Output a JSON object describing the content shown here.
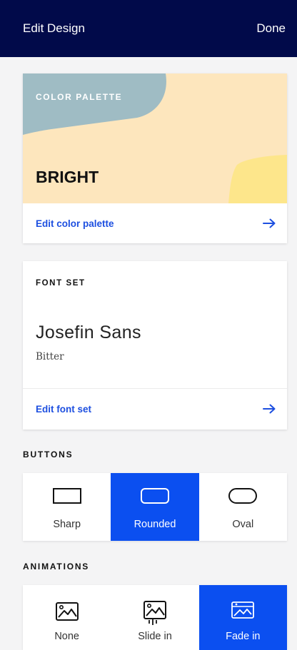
{
  "header": {
    "title": "Edit Design",
    "done_label": "Done"
  },
  "palette_card": {
    "label": "COLOR PALETTE",
    "name": "BRIGHT",
    "edit_label": "Edit color palette",
    "colors": {
      "background": "#fde6bd",
      "blue": "#9fbcc4",
      "yellow": "#fde68b"
    }
  },
  "font_card": {
    "label": "FONT SET",
    "primary_font": "Josefin Sans",
    "secondary_font": "Bitter",
    "edit_label": "Edit font set"
  },
  "buttons": {
    "title": "BUTTONS",
    "options": [
      {
        "label": "Sharp",
        "icon": "sharp-rectangle-icon"
      },
      {
        "label": "Rounded",
        "icon": "rounded-rectangle-icon"
      },
      {
        "label": "Oval",
        "icon": "oval-icon"
      }
    ],
    "selected": "Rounded"
  },
  "animations": {
    "title": "ANIMATIONS",
    "options": [
      {
        "label": "None",
        "icon": "image-icon"
      },
      {
        "label": "Slide in",
        "icon": "image-slide-icon"
      },
      {
        "label": "Fade in",
        "icon": "image-fade-icon"
      }
    ],
    "selected": "Fade in"
  },
  "colors": {
    "header_bg": "#010a4a",
    "accent": "#0b4ff0",
    "link": "#1d4fe0"
  }
}
